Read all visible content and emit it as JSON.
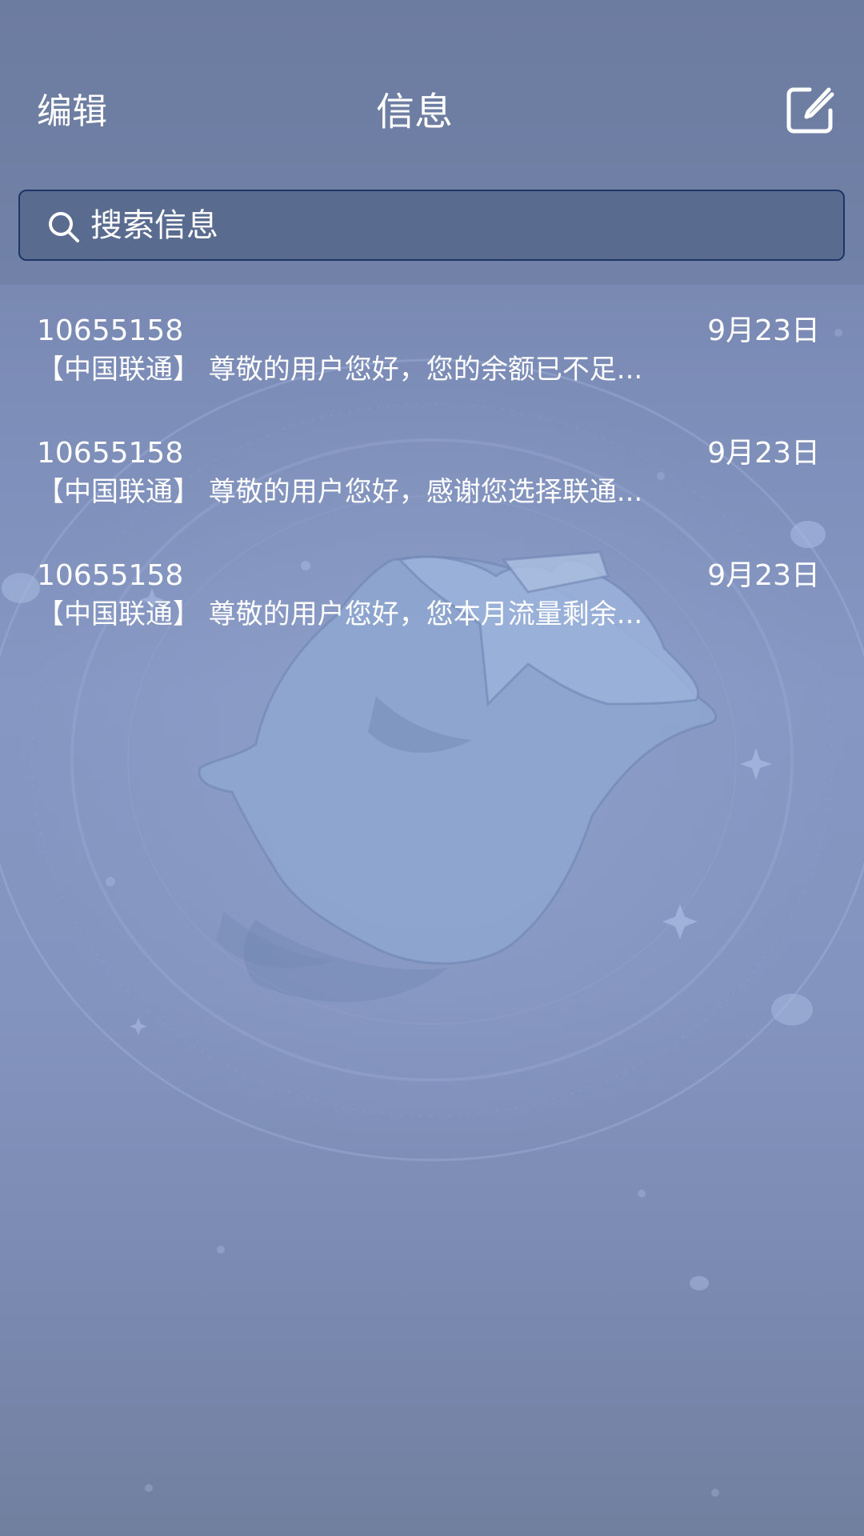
{
  "header": {
    "edit_label": "编辑",
    "title": "信息",
    "compose_icon": "compose-icon"
  },
  "search": {
    "placeholder": "搜索信息",
    "icon": "search-icon"
  },
  "messages": [
    {
      "sender": "10655158",
      "date": "9月23日",
      "preview": "【中国联通】 尊敬的用户您好，您的余额已不足..."
    },
    {
      "sender": "10655158",
      "date": "9月23日",
      "preview": "【中国联通】 尊敬的用户您好，感谢您选择联通..."
    },
    {
      "sender": "10655158",
      "date": "9月23日",
      "preview": "【中国联通】 尊敬的用户您好，您本月流量剩余..."
    }
  ],
  "colors": {
    "background": "#8394bf",
    "search_field": "#5a6b90",
    "search_border": "#1e3566",
    "text": "#ffffff"
  }
}
